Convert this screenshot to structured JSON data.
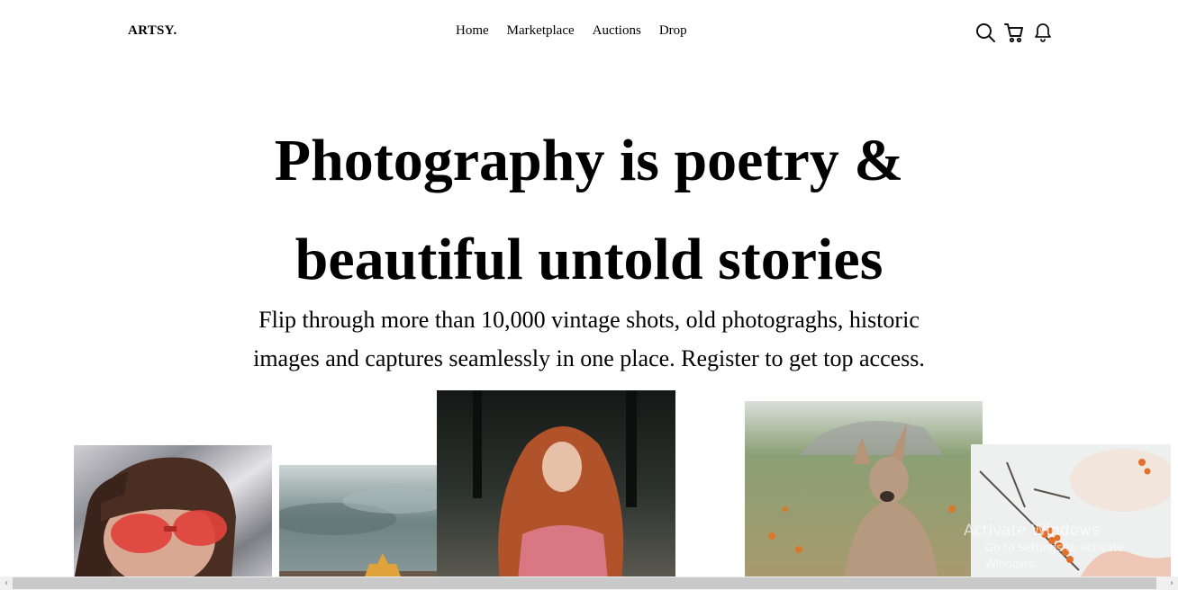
{
  "header": {
    "logo": "ARTSY.",
    "nav": [
      "Home",
      "Marketplace",
      "Auctions",
      "Drop"
    ],
    "icons": [
      "search-icon",
      "cart-icon",
      "bell-icon"
    ]
  },
  "hero": {
    "title_line1": "Photography is poetry &",
    "title_line2": "beautiful untold stories",
    "subtitle_line1": "Flip through more than 10,000 vintage shots, old photograghs, historic",
    "subtitle_line2": "images and captures seamlessly in one place. Register to get top access."
  },
  "gallery": {
    "photos": [
      "portrait-red-sunglasses",
      "autumn-leaf-cloudy-sky",
      "red-haired-girl-forest",
      "kangaroo-field",
      "orange-berries-hand"
    ]
  },
  "watermark": {
    "line1": "Activate Windows",
    "line2": "Go to Settings to activate Windows."
  },
  "colors": {
    "background": "#ffffff",
    "text": "#000000",
    "scrollbar_track": "#f0f0f0",
    "scrollbar_thumb": "#c9c9c9"
  }
}
